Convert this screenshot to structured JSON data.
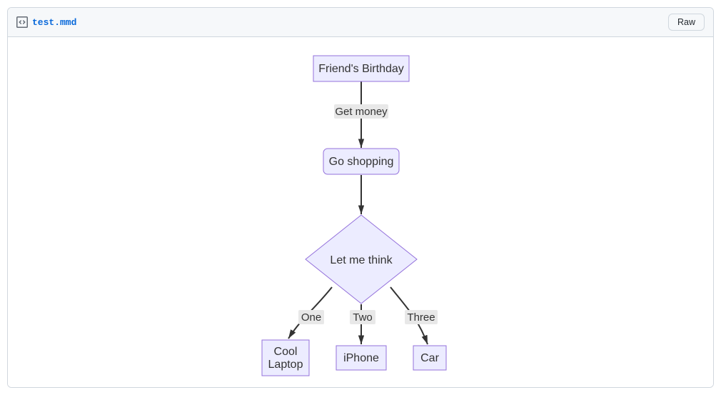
{
  "header": {
    "file_name": "test.mmd",
    "raw_label": "Raw"
  },
  "diagram": {
    "nodes": {
      "A": "Friend's Birthday",
      "B": "Go shopping",
      "C": "Let me think",
      "D1": "Cool",
      "D2": "Laptop",
      "D_full": "Cool Laptop",
      "E": "iPhone",
      "F": "Car"
    },
    "edge_labels": {
      "AB": "Get money",
      "CD": "One",
      "CE": "Two",
      "CF": "Three"
    }
  }
}
